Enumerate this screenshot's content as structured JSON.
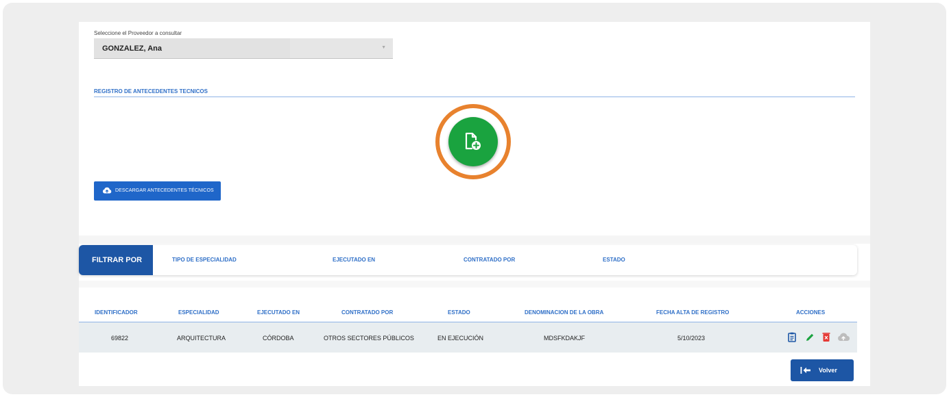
{
  "provider": {
    "label": "Seleccione el Proveedor a consultar",
    "selected": "GONZALEZ, Ana"
  },
  "registro": {
    "title": "REGISTRO DE ANTECEDENTES TECNICOS",
    "add_icon": "file-add-icon",
    "add_highlight_color": "#e8822e",
    "add_button_color": "#1aa33f"
  },
  "download_button": {
    "label": "DESCARGAR ANTECEDENTES TÉCNICOS",
    "icon": "cloud-upload-icon"
  },
  "filter": {
    "tab_label": "FILTRAR POR",
    "options": [
      "TIPO DE ESPECIALIDAD",
      "EJECUTADO EN",
      "CONTRATADO POR",
      "ESTADO"
    ]
  },
  "table": {
    "columns": [
      "IDENTIFICADOR",
      "ESPECIALIDAD",
      "EJECUTADO EN",
      "CONTRATADO POR",
      "ESTADO",
      "DENOMINACION DE LA OBRA",
      "FECHA ALTA DE REGISTRO",
      "ACCIONES"
    ],
    "rows": [
      {
        "identificador": "69822",
        "especialidad": "ARQUITECTURA",
        "ejecutado_en": "CÓRDOBA",
        "contratado_por": "OTROS SECTORES PÚBLICOS",
        "estado": "EN EJECUCIÓN",
        "denominacion": "MDSFKDAKJF",
        "fecha_alta": "5/10/2023",
        "actions": [
          "clipboard-icon",
          "edit-pencil-icon",
          "delete-icon",
          "cloud-upload-icon"
        ]
      }
    ]
  },
  "back_button": {
    "label": "Volver",
    "icon": "arrow-left-bar-icon"
  },
  "colors": {
    "primary": "#1d56a5",
    "link_blue": "#2f6fc7",
    "success": "#1aa33f",
    "danger": "#e53935"
  }
}
